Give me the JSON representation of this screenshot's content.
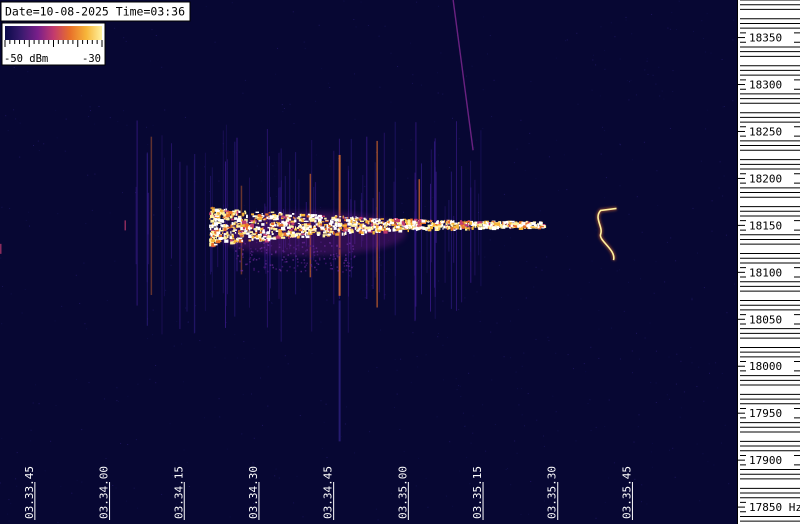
{
  "header": {
    "date_time": "Date=10-08-2025 Time=03:36"
  },
  "colorbar": {
    "min_label": "-50 dBm",
    "max_label": "-30",
    "colors": [
      "#0a0a4a",
      "#3a1a6e",
      "#7a1f8a",
      "#c23a6e",
      "#e8702a",
      "#f7b63a",
      "#fff2a0"
    ]
  },
  "chart_data": {
    "type": "heatmap",
    "title": "",
    "xlabel": "",
    "ylabel": "",
    "background_color": "#070733",
    "x_range": [
      "03:33:38",
      "03:36:06"
    ],
    "y_range_hz": [
      17832,
      18390
    ],
    "intensity_range_dbm": [
      -50,
      -30
    ],
    "x_ticks": [
      "03.33.45",
      "03.34.00",
      "03.34.15",
      "03.34.30",
      "03.34.45",
      "03.35.00",
      "03.35.15",
      "03.35.30",
      "03.35.45"
    ],
    "y_ticks": [
      18350,
      18300,
      18250,
      18200,
      18150,
      18100,
      18050,
      18000,
      17950,
      17900,
      17850
    ],
    "y_unit": "Hz",
    "features": [
      {
        "name": "main-signal",
        "time_start": "03:34:20",
        "time_end": "03:35:27",
        "center_freq_hz": 18152,
        "peak_dbm": -30
      },
      {
        "name": "doppler-trace",
        "time_start": "03:35:38",
        "time_end": "03:35:41",
        "freq_range_hz": [
          18113,
          18168
        ],
        "peak_dbm": -32
      },
      {
        "name": "diagonal-streak",
        "time_start": "03:35:09",
        "time_end": "03:35:13",
        "freq_range_hz": [
          18230,
          18390
        ],
        "peak_dbm": -42
      }
    ]
  }
}
